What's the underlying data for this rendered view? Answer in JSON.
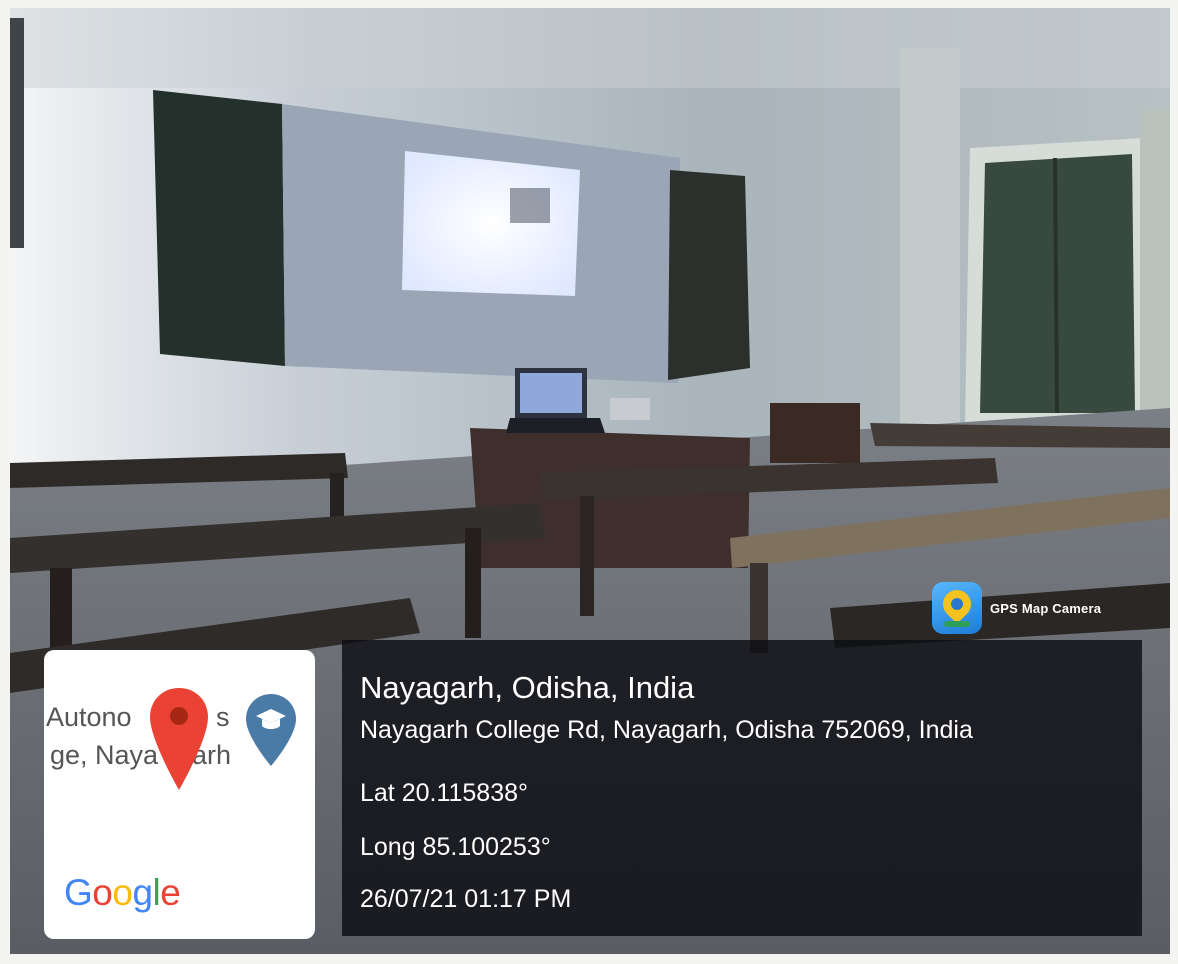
{
  "watermark": {
    "app_name": "GPS Map Camera",
    "icon": "gps-map-camera-app-icon"
  },
  "map_thumbnail": {
    "label_line1": "Autono",
    "label_line1_tail": "s",
    "label_line2": "ge, Naya",
    "label_line2_tail": "arh",
    "brand": [
      "G",
      "o",
      "o",
      "g",
      "l",
      "e"
    ],
    "pin_icon": "red-location-pin-icon",
    "place_icon": "education-place-pin-icon",
    "colors": {
      "pin": "#ea4335",
      "place_pin": "#4a7aa6"
    }
  },
  "location": {
    "place": "Nayagarh, Odisha, India",
    "address": "Nayagarh College Rd, Nayagarh, Odisha 752069, India",
    "latitude": "Lat 20.115838°",
    "longitude": "Long 85.100253°",
    "datetime": "26/07/21 01:17 PM"
  }
}
